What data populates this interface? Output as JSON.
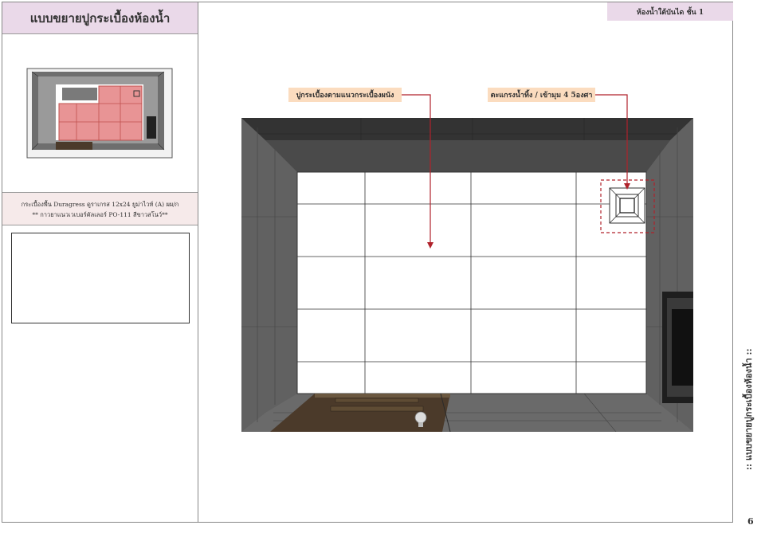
{
  "left_panel": {
    "title": "แบบขยายปูกระเบื้องห้องน้ำ",
    "spec_line1": "กระเบื้องพื้น Duragress ดูราเกรส 12x24 ยูม่าไวท์ (A) ผผ/ก",
    "spec_line2": "** กาวยาแนวเวเบอร์คัลเลอร์ PO-111 สีขาวสโนว์**"
  },
  "header": {
    "location": "ห้องน้ำใต้บันได ชั้น 1"
  },
  "drawing": {
    "callout_wall": "ปูกระเบื้องตามแนวกระเบื้องผนัง",
    "callout_drain": "ตะแกรงน้ำทิ้ง / เข้ามุม 4 5องศา"
  },
  "footer": {
    "side_title": ":: แบบขยายปูกระเบื้องห้องน้ำ ::",
    "page_number": "6"
  },
  "colors": {
    "accent_pink": "#ead9e9",
    "callout_bg": "#fbdcbf",
    "callout_line": "#b0222b",
    "wall_dark": "#5a5a5a",
    "door_wood": "#4b3a2a"
  }
}
